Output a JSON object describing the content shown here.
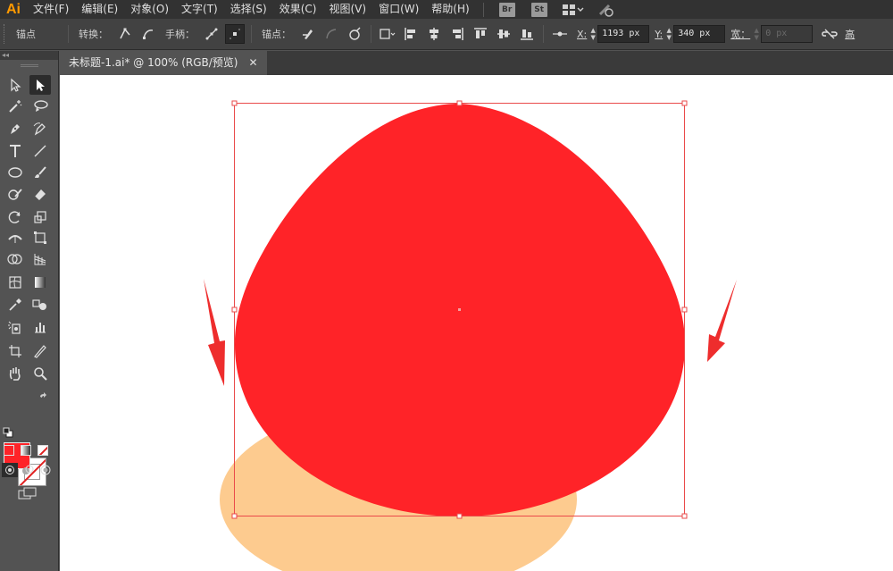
{
  "app": {
    "logo": "Ai"
  },
  "menu": {
    "items": [
      "文件(F)",
      "编辑(E)",
      "对象(O)",
      "文字(T)",
      "选择(S)",
      "效果(C)",
      "视图(V)",
      "窗口(W)",
      "帮助(H)"
    ],
    "badges": [
      "Br",
      "St"
    ],
    "workspace_switcher": "workspace-grid"
  },
  "control": {
    "anchor_label": "锚点",
    "convert_label": "转换：",
    "handle_label": "手柄：",
    "anchors_label": "锚点：",
    "x_label": "X:",
    "x_value": "1193 px",
    "y_label": "Y:",
    "y_value": "340 px",
    "width_label": "宽：",
    "width_value": "0 px",
    "trailing_label": "高"
  },
  "document": {
    "tab_title": "未标题-1.ai* @ 100% (RGB/预览)",
    "close_glyph": "✕"
  },
  "tools_panel": {
    "collapse_glyph": "◂◂"
  },
  "colors": {
    "fill": "#ff2328",
    "shape_red": "#ff2328",
    "shape_orange": "#fdcb8f",
    "selection": "#ea4a4a",
    "arrow": "#ee2d2d",
    "app_logo": "#ff9a00"
  }
}
